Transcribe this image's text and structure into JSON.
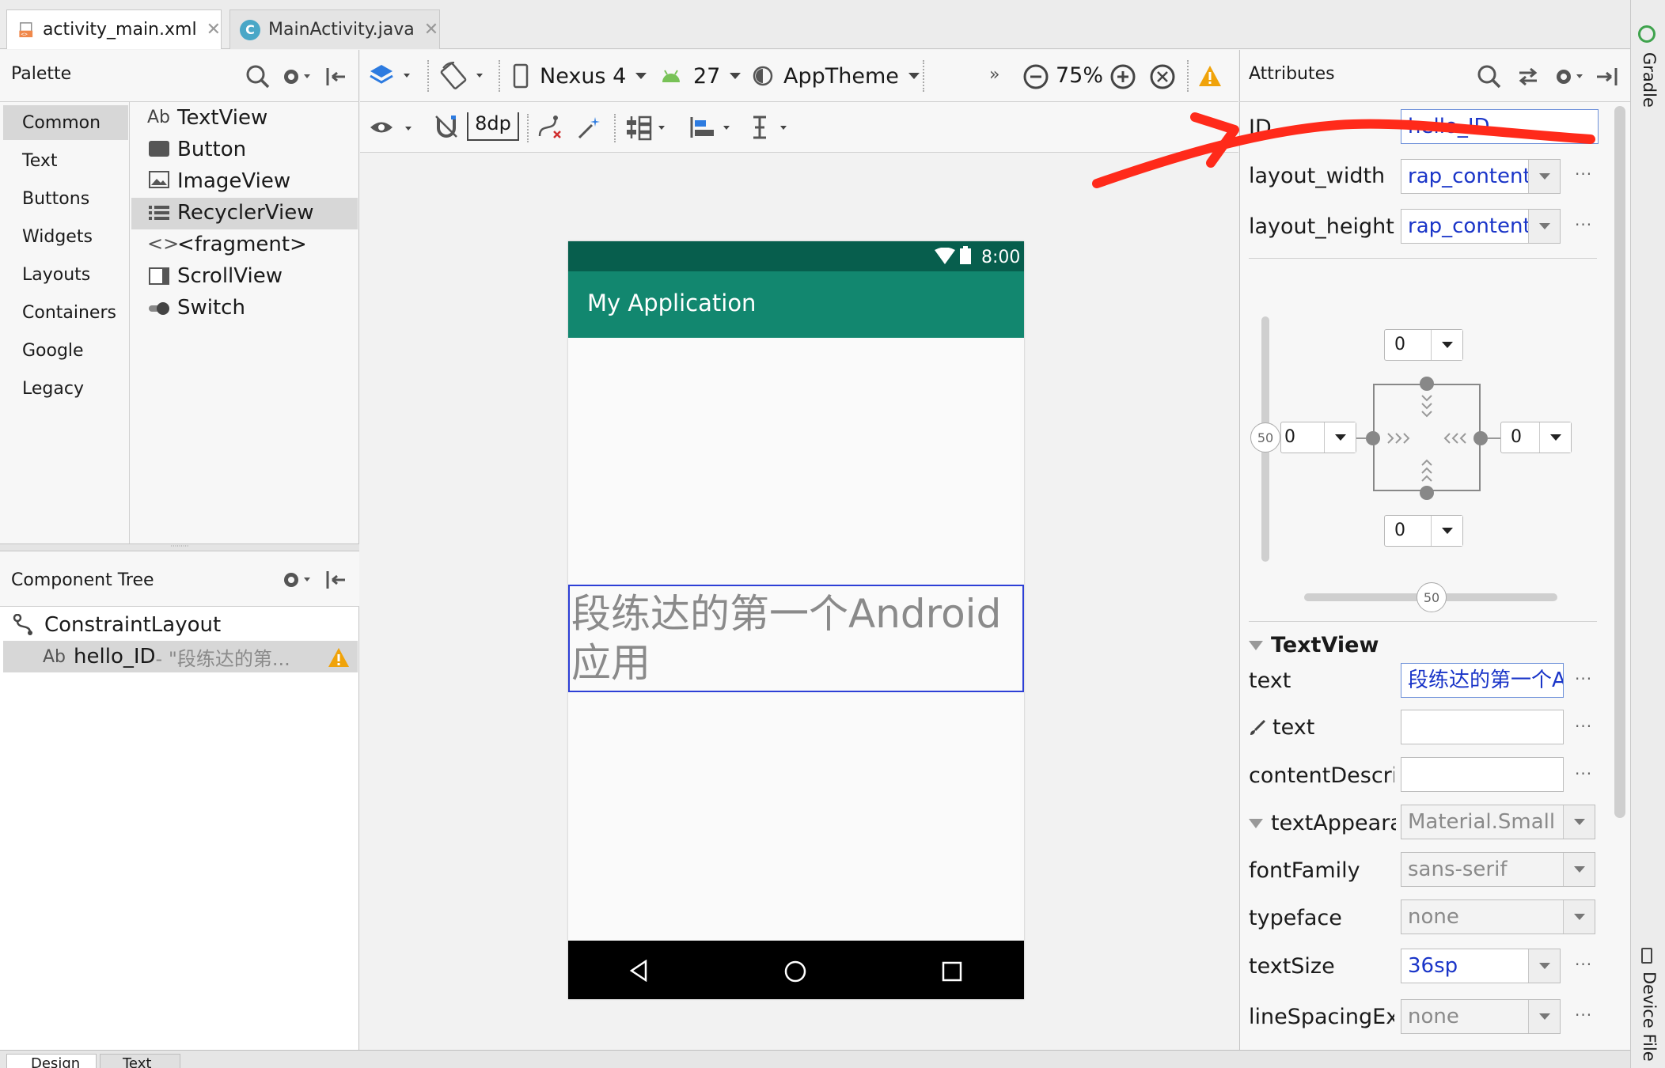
{
  "tabs": [
    {
      "label": "activity_main.xml",
      "active": true
    },
    {
      "label": "MainActivity.java",
      "active": false
    }
  ],
  "palette": {
    "title": "Palette",
    "categories": [
      "Common",
      "Text",
      "Buttons",
      "Widgets",
      "Layouts",
      "Containers",
      "Google",
      "Legacy"
    ],
    "selected_category": "Common",
    "items": [
      {
        "label": "TextView",
        "icon": "ab-text-icon"
      },
      {
        "label": "Button",
        "icon": "button-icon"
      },
      {
        "label": "ImageView",
        "icon": "image-icon"
      },
      {
        "label": "RecyclerView",
        "icon": "list-icon",
        "selected": true
      },
      {
        "label": "<fragment>",
        "icon": "code-brackets-icon"
      },
      {
        "label": "ScrollView",
        "icon": "scrollview-icon"
      },
      {
        "label": "Switch",
        "icon": "switch-icon"
      }
    ]
  },
  "component_tree": {
    "title": "Component Tree",
    "root": "ConstraintLayout",
    "child_id": "hello_ID",
    "child_text": "- \"段练达的第...",
    "child_prefix": "Ab"
  },
  "toolbar": {
    "device": "Nexus 4",
    "api": "27",
    "theme": "AppTheme",
    "zoom": "75%",
    "margin": "8dp",
    "overflow": "»"
  },
  "phone": {
    "time": "8:00",
    "app_title": "My Application",
    "textview_text": "段练达的第一个Android应用"
  },
  "attributes": {
    "title": "Attributes",
    "id_label": "ID",
    "id_value": "hello_ID",
    "layout_width_label": "layout_width",
    "layout_width_value": "rap_content",
    "layout_height_label": "layout_height",
    "layout_height_value": "rap_content",
    "constraint": {
      "top": "0",
      "left": "0",
      "right": "0",
      "bottom": "0",
      "vbias": "50",
      "hbias": "50"
    },
    "section": "TextView",
    "rows": [
      {
        "label": "text",
        "value": "段练达的第一个A"
      },
      {
        "label": "text",
        "value": ""
      },
      {
        "label": "contentDescrip",
        "value": ""
      },
      {
        "label": "textAppeara",
        "value": "Material.Small"
      },
      {
        "label": "fontFamily",
        "value": "sans-serif"
      },
      {
        "label": "typeface",
        "value": "none"
      },
      {
        "label": "textSize",
        "value": "36sp"
      },
      {
        "label": "lineSpacingExt",
        "value": "none"
      }
    ]
  },
  "side_tabs": {
    "gradle": "Gradle",
    "device_file": "Device File"
  },
  "bottom_tabs": [
    "Design",
    "Text"
  ],
  "colors": {
    "accent_blue": "#1a35c8",
    "status_bar": "#075e4d",
    "app_bar": "#12876f",
    "annotation_red": "#ff2a1a",
    "warn": "#f0a30a"
  }
}
